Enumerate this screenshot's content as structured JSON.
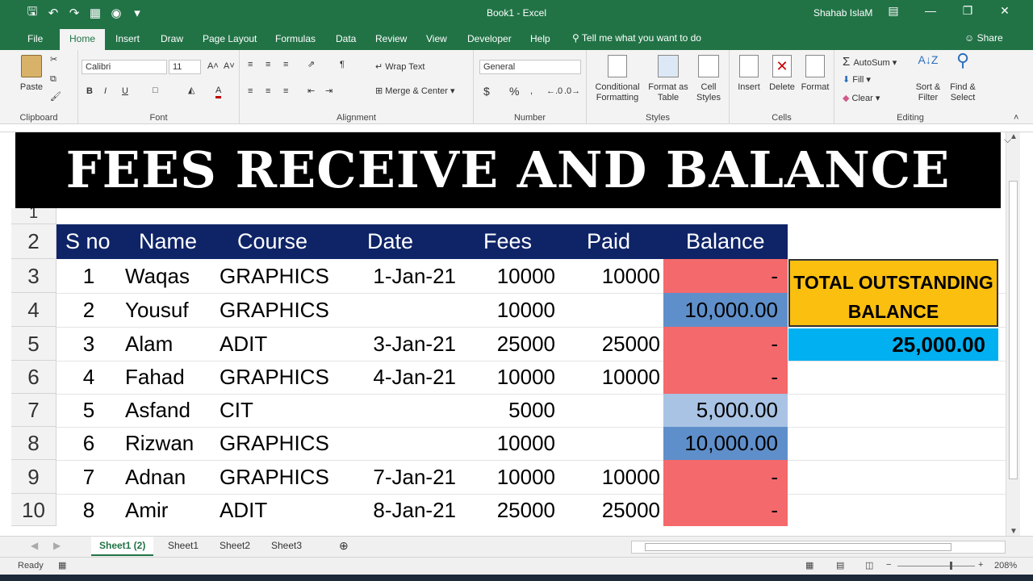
{
  "app": {
    "title": "Book1  -  Excel",
    "user": "Shahab IslaM"
  },
  "tabs": [
    "File",
    "Home",
    "Insert",
    "Draw",
    "Page Layout",
    "Formulas",
    "Data",
    "Review",
    "View",
    "Developer",
    "Help"
  ],
  "tell_me": "Tell me what you want to do",
  "share": "Share",
  "ribbon": {
    "clipboard": {
      "label": "Clipboard",
      "paste": "Paste"
    },
    "font": {
      "label": "Font",
      "name": "Calibri",
      "size": "11",
      "bold": "B",
      "italic": "I",
      "underline": "U"
    },
    "alignment": {
      "label": "Alignment",
      "wrap": "Wrap Text",
      "merge": "Merge & Center"
    },
    "number": {
      "label": "Number",
      "format": "General",
      "currency": "$",
      "percent": "%"
    },
    "styles": {
      "label": "Styles",
      "conditional": "Conditional",
      "conditional2": "Formatting",
      "format_as": "Format as",
      "format_as2": "Table",
      "cell_styles": "Cell",
      "cell_styles2": "Styles"
    },
    "cells": {
      "label": "Cells",
      "insert": "Insert",
      "delete": "Delete",
      "format": "Format"
    },
    "editing": {
      "label": "Editing",
      "autosum": "AutoSum",
      "fill": "Fill",
      "clear": "Clear",
      "sort": "Sort &",
      "sort2": "Filter",
      "find": "Find &",
      "find2": "Select"
    }
  },
  "sheet": {
    "banner": "FEES RECEIVE AND BALANCE",
    "row_numbers": [
      "1",
      "2",
      "3",
      "4",
      "5",
      "6",
      "7",
      "8",
      "9",
      "10"
    ],
    "headers": [
      "S no",
      "Name",
      "Course",
      "Date",
      "Fees",
      "Paid",
      "Balance"
    ],
    "rows": [
      {
        "sno": "1",
        "name": "Waqas",
        "course": "GRAPHICS",
        "date": "1-Jan-21",
        "fees": "10000",
        "paid": "10000",
        "balance": "-",
        "color": "#f4696b"
      },
      {
        "sno": "2",
        "name": "Yousuf",
        "course": "GRAPHICS",
        "date": "",
        "fees": "10000",
        "paid": "",
        "balance": "10,000.00",
        "color": "#5f8fca"
      },
      {
        "sno": "3",
        "name": "Alam",
        "course": "ADIT",
        "date": "3-Jan-21",
        "fees": "25000",
        "paid": "25000",
        "balance": "-",
        "color": "#f4696b"
      },
      {
        "sno": "4",
        "name": "Fahad",
        "course": "GRAPHICS",
        "date": "4-Jan-21",
        "fees": "10000",
        "paid": "10000",
        "balance": "-",
        "color": "#f4696b"
      },
      {
        "sno": "5",
        "name": "Asfand",
        "course": "CIT",
        "date": "",
        "fees": "5000",
        "paid": "",
        "balance": "5,000.00",
        "color": "#a9c3e4"
      },
      {
        "sno": "6",
        "name": "Rizwan",
        "course": "GRAPHICS",
        "date": "",
        "fees": "10000",
        "paid": "",
        "balance": "10,000.00",
        "color": "#5f8fca"
      },
      {
        "sno": "7",
        "name": "Adnan",
        "course": "GRAPHICS",
        "date": "7-Jan-21",
        "fees": "10000",
        "paid": "10000",
        "balance": "-",
        "color": "#f4696b"
      },
      {
        "sno": "8",
        "name": "Amir",
        "course": "ADIT",
        "date": "8-Jan-21",
        "fees": "25000",
        "paid": "25000",
        "balance": "-",
        "color": "#f4696b"
      }
    ],
    "total_label_1": "TOTAL OUTSTANDING",
    "total_label_2": "BALANCE",
    "total_value": "25,000.00"
  },
  "sheet_tabs": [
    "Sheet1 (2)",
    "Sheet1",
    "Sheet2",
    "Sheet3"
  ],
  "status": {
    "ready": "Ready",
    "zoom": "208%"
  }
}
